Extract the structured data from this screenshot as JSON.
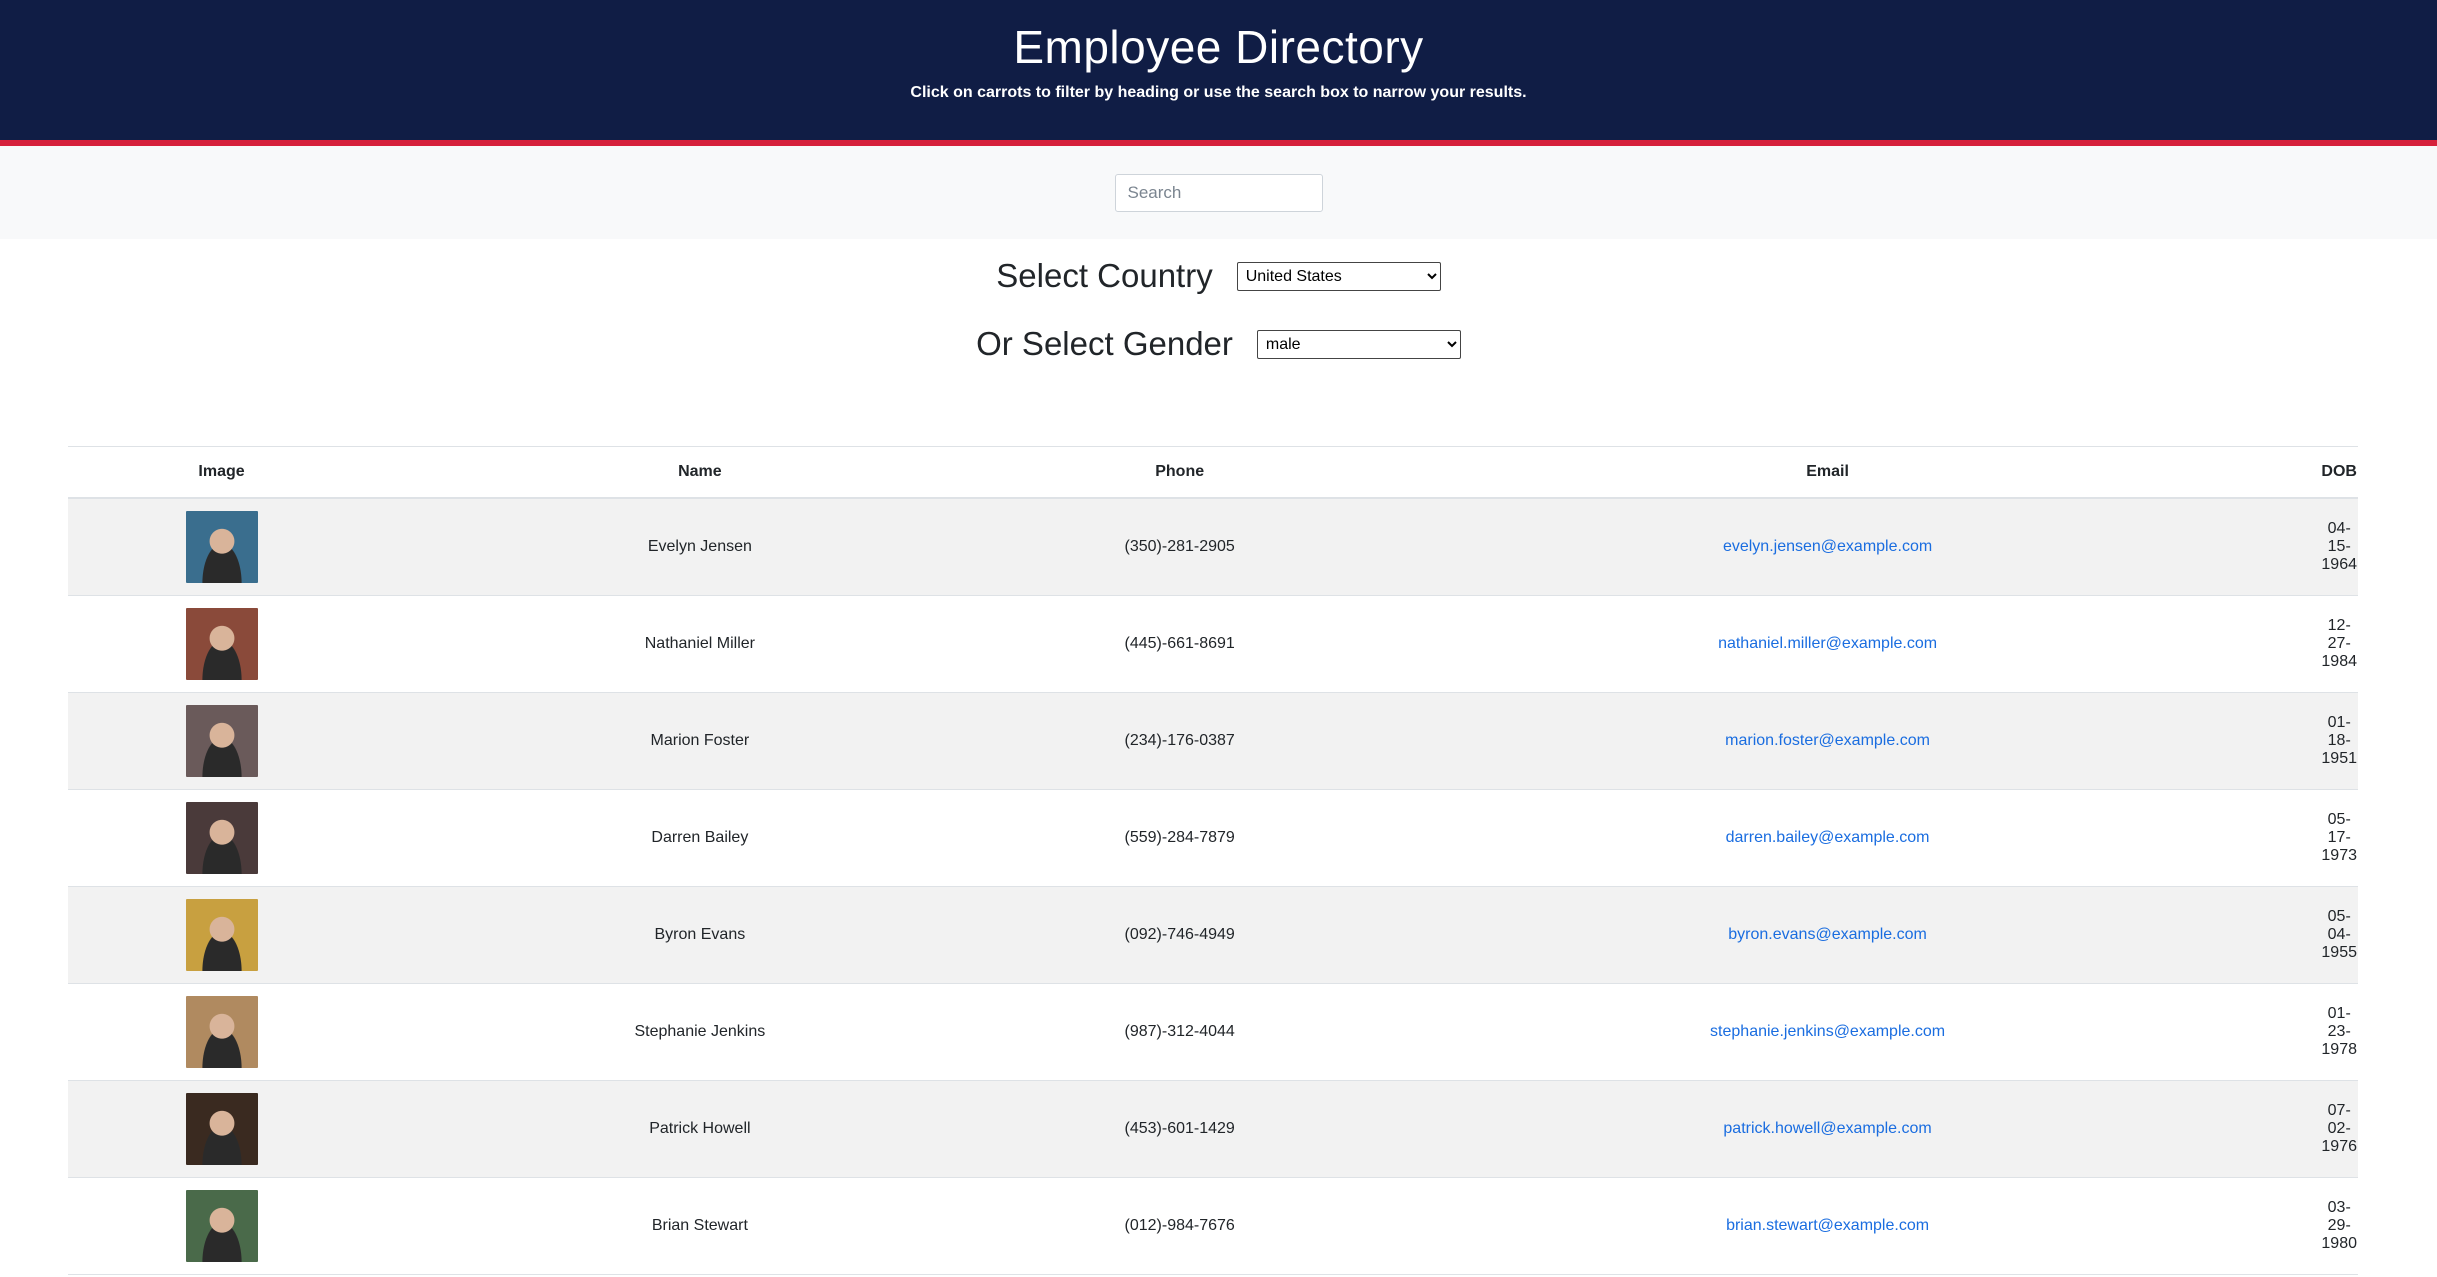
{
  "header": {
    "title": "Employee Directory",
    "subtitle": "Click on carrots to filter by heading or use the search box to narrow your results."
  },
  "search": {
    "placeholder": "Search",
    "value": ""
  },
  "filters": {
    "country_label": "Select Country",
    "country_selected": "United States",
    "gender_label": "Or Select Gender",
    "gender_selected": "male"
  },
  "table": {
    "headers": {
      "image": "Image",
      "name": "Name",
      "phone": "Phone",
      "email": "Email",
      "dob": "DOB"
    },
    "rows": [
      {
        "name": "Evelyn Jensen",
        "phone": "(350)-281-2905",
        "email": "evelyn.jensen@example.com",
        "dob": "04-15-1964",
        "avatar_color": "#3a6e8e"
      },
      {
        "name": "Nathaniel Miller",
        "phone": "(445)-661-8691",
        "email": "nathaniel.miller@example.com",
        "dob": "12-27-1984",
        "avatar_color": "#8a4a3a"
      },
      {
        "name": "Marion Foster",
        "phone": "(234)-176-0387",
        "email": "marion.foster@example.com",
        "dob": "01-18-1951",
        "avatar_color": "#6a5a5a"
      },
      {
        "name": "Darren Bailey",
        "phone": "(559)-284-7879",
        "email": "darren.bailey@example.com",
        "dob": "05-17-1973",
        "avatar_color": "#4a3a3a"
      },
      {
        "name": "Byron Evans",
        "phone": "(092)-746-4949",
        "email": "byron.evans@example.com",
        "dob": "05-04-1955",
        "avatar_color": "#c8a040"
      },
      {
        "name": "Stephanie Jenkins",
        "phone": "(987)-312-4044",
        "email": "stephanie.jenkins@example.com",
        "dob": "01-23-1978",
        "avatar_color": "#b08a60"
      },
      {
        "name": "Patrick Howell",
        "phone": "(453)-601-1429",
        "email": "patrick.howell@example.com",
        "dob": "07-02-1976",
        "avatar_color": "#3a2a20"
      },
      {
        "name": "Brian Stewart",
        "phone": "(012)-984-7676",
        "email": "brian.stewart@example.com",
        "dob": "03-29-1980",
        "avatar_color": "#4a6a4a"
      }
    ]
  }
}
